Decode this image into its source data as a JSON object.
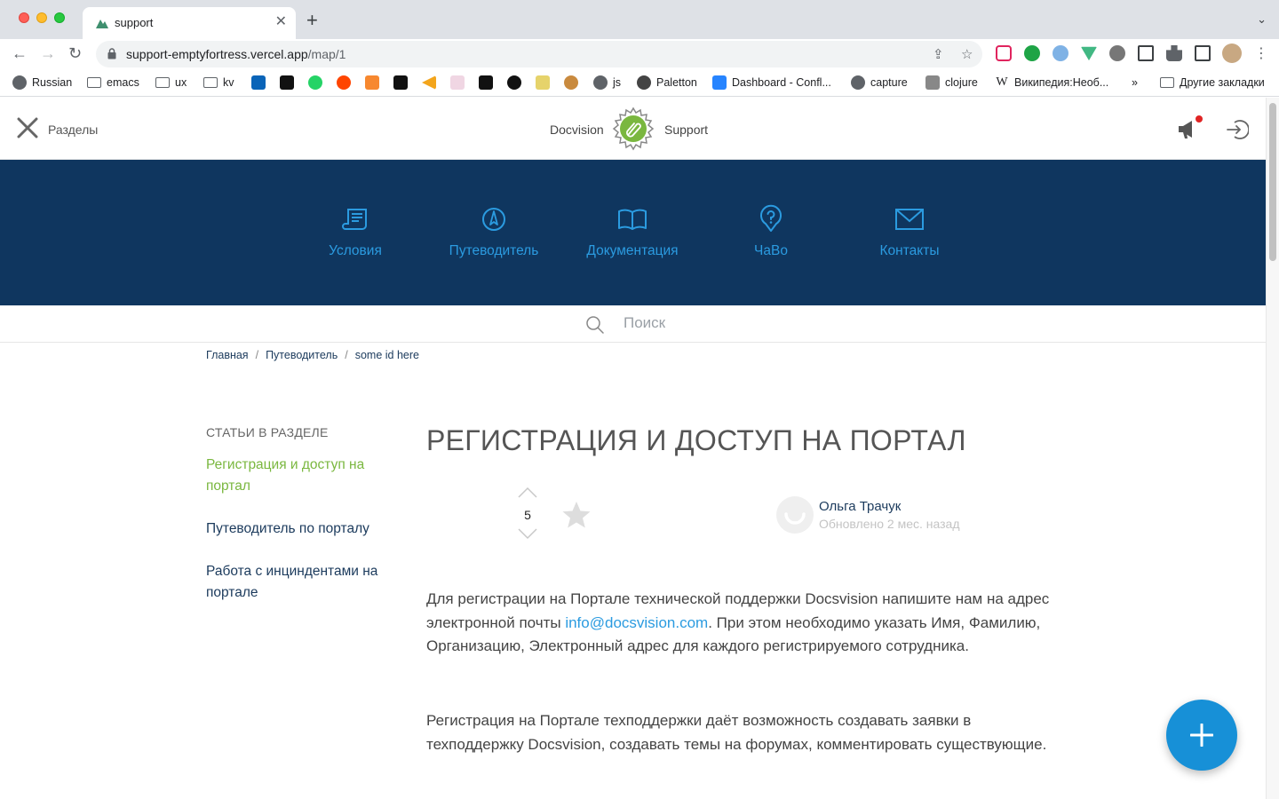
{
  "browser": {
    "tab_title": "support",
    "url_host": "support-emptyfortress.vercel.app",
    "url_path": "/map/1",
    "bookmarks": [
      {
        "label": "Russian",
        "icon": "globe-icon"
      },
      {
        "label": "emacs",
        "icon": "folder-icon"
      },
      {
        "label": "ux",
        "icon": "folder-icon"
      },
      {
        "label": "kv",
        "icon": "folder-icon"
      },
      {
        "label": "js",
        "icon": "globe-icon"
      },
      {
        "label": "Paletton",
        "icon": "paletton-icon"
      },
      {
        "label": "Dashboard - Confl...",
        "icon": "confluence-icon"
      },
      {
        "label": "capture",
        "icon": "globe-icon"
      },
      {
        "label": "clojure",
        "icon": "clojure-icon"
      },
      {
        "label": "Википедия:Необ...",
        "icon": "wikipedia-icon"
      },
      {
        "label": "»",
        "icon": "chevron-icon"
      },
      {
        "label": "Другие закладки",
        "icon": "folder-icon"
      }
    ]
  },
  "header": {
    "menu_label": "Разделы",
    "brand_left": "Docvision",
    "brand_right": "Support"
  },
  "hero_nav": [
    {
      "label": "Условия",
      "icon": "document-icon"
    },
    {
      "label": "Путеводитель",
      "icon": "compass-icon"
    },
    {
      "label": "Документация",
      "icon": "book-icon"
    },
    {
      "label": "ЧаВо",
      "icon": "question-icon"
    },
    {
      "label": "Контакты",
      "icon": "mail-icon"
    }
  ],
  "search": {
    "placeholder": "Поиск"
  },
  "breadcrumb": [
    "Главная",
    "Путеводитель",
    "some id here"
  ],
  "sidebar": {
    "heading": "СТАТЬИ В РАЗДЕЛЕ",
    "items": [
      {
        "label": "Регистрация и доступ на портал",
        "active": true
      },
      {
        "label": "Путеводитель по порталу",
        "active": false
      },
      {
        "label": "Работа с инциндентами на портале",
        "active": false
      }
    ]
  },
  "article": {
    "title": "РЕГИСТРАЦИЯ И ДОСТУП НА ПОРТАЛ",
    "votes": "5",
    "author": "Ольга Трачук",
    "updated": "Обновлено 2 мес. назад",
    "p1_before": "Для регистрации на Портале технической поддержки Docsvision напишите нам на адрес электронной почты ",
    "p1_link": "info@docsvision.com",
    "p1_after": ". При этом необходимо указать Имя, Фамилию, Организацию, Электронный адрес для каждого регистрируемого сотрудника.",
    "p2": "Регистрация на Портале техподдержки даёт возможность создавать заявки в техподдержку Docsvision, создавать темы на форумах, комментировать существующие."
  },
  "colors": {
    "hero_bg": "#0f365f",
    "link_blue": "#2b9be0",
    "active_green": "#7ab73f",
    "fab_blue": "#1790d7"
  }
}
